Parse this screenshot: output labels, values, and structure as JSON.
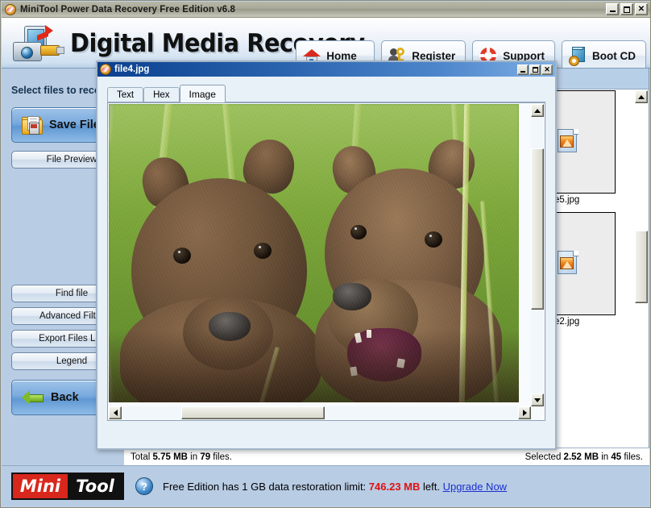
{
  "window": {
    "title": "MiniTool Power Data Recovery Free Edition v6.8",
    "icon": "minitool-app-icon",
    "buttons": {
      "minimize": "_",
      "maximize": "□",
      "close": "✕"
    }
  },
  "banner": {
    "title": "Digital Media Recovery",
    "logo_icon": "media-recovery-logo",
    "nav": [
      {
        "label": "Home",
        "icon": "home-icon"
      },
      {
        "label": "Register",
        "icon": "key-person-icon"
      },
      {
        "label": "Support",
        "icon": "lifering-icon"
      },
      {
        "label": "Boot CD",
        "icon": "boot-cd-icon"
      }
    ]
  },
  "sidebar": {
    "heading": "Select files to recover",
    "save_button": {
      "label": "Save Files",
      "icon": "save-folder-icon"
    },
    "buttons": [
      {
        "label": "File Preview"
      },
      {
        "label": "Find file"
      },
      {
        "label": "Advanced Filter"
      },
      {
        "label": "Export Files List"
      },
      {
        "label": "Legend"
      }
    ],
    "back_button": {
      "label": "Back",
      "icon": "back-arrow-icon"
    }
  },
  "files_panel": {
    "items": [
      {
        "name": "e5.jpg",
        "icon": "jpg-file-icon"
      },
      {
        "name": "e2.jpg",
        "icon": "jpg-file-icon"
      }
    ],
    "scrollbar": {
      "up": "scroll-up-arrow",
      "down": "scroll-down-arrow"
    }
  },
  "preview_window": {
    "title": "file4.jpg",
    "icon": "minitool-app-icon",
    "buttons": {
      "minimize": "_",
      "maximize": "□",
      "close": "✕"
    },
    "tabs": [
      {
        "label": "Text",
        "active": false
      },
      {
        "label": "Hex",
        "active": false
      },
      {
        "label": "Image",
        "active": true
      }
    ],
    "image_alt": "two brown bear cubs in green grass"
  },
  "status": {
    "total": "Total ",
    "total_size": "5.75 MB",
    "total_mid": " in ",
    "total_count": "79",
    "total_end": " files.",
    "selected": "Selected ",
    "selected_size": "2.52 MB",
    "selected_mid": " in ",
    "selected_count": "45",
    "selected_end": " files."
  },
  "footer": {
    "logo_left": "Mini",
    "logo_right": "Tool",
    "help_icon": "?",
    "message_pre": "Free Edition has 1 GB data restoration limit: ",
    "limit_left": "746.23 MB",
    "message_post": " left. ",
    "upgrade_link": "Upgrade Now"
  },
  "colors": {
    "accent_blue": "#1a3f8f",
    "panel_blue": "#b8cce4",
    "alert_red": "#e01010",
    "link_blue": "#1a2fd0",
    "brand_red": "#d8271c"
  }
}
